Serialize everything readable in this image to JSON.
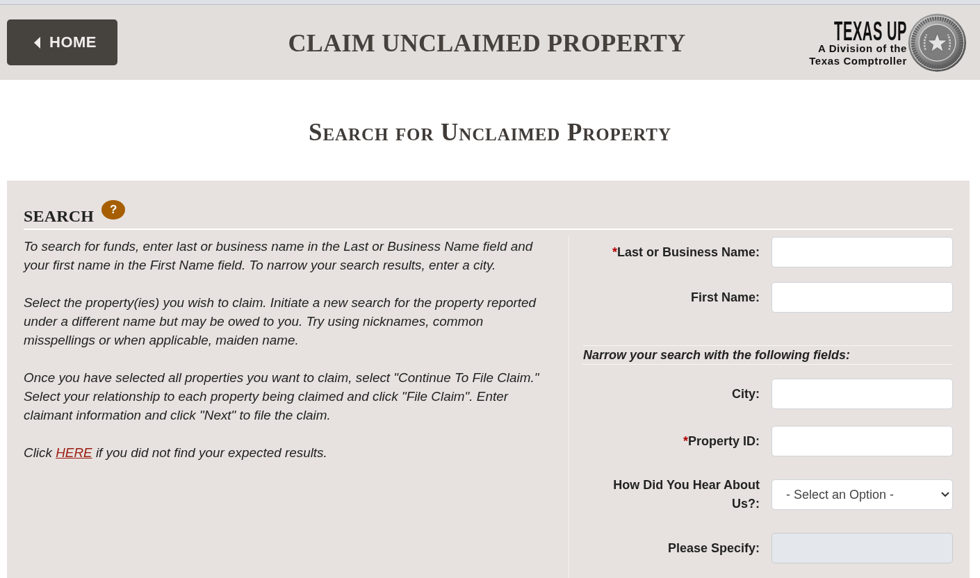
{
  "header": {
    "home_button": "HOME",
    "title": "CLAIM UNCLAIMED PROPERTY",
    "logo": {
      "name": "TEXAS UP",
      "tagline": [
        "A Division of the",
        "Texas Comptroller"
      ]
    }
  },
  "page_title": "Search for Unclaimed Property",
  "search_panel": {
    "heading": "SEARCH",
    "help_button": "?",
    "instructions": [
      {
        "text": "To search for funds, enter last or business name in the Last or Business Name field and your first name in the First Name field. To narrow your search results, enter a city."
      },
      {
        "text": "Select the property(ies) you wish to claim. Initiate a new search for the property reported under a different name but may be owed to you. Try using nicknames, common misspellings or when applicable, maiden name."
      },
      {
        "text": "Once you have selected all properties you want to claim, select \"Continue To File Claim.\" Select your relationship to each property being claimed and click \"File Claim\". Enter claimant information and click \"Next\" to file the claim."
      },
      {
        "text": "Click ",
        "link": "HERE",
        "text_after": " if you did not find your expected results."
      }
    ],
    "form": {
      "fields": [
        {
          "kind": "text",
          "required_mark": "*",
          "label": "Last or Business Name:",
          "disabled": false
        },
        {
          "kind": "text",
          "label": "First Name:",
          "disabled": false
        }
      ],
      "narrow_note": "Narrow your search with the following fields:",
      "narrow_fields": [
        {
          "kind": "text",
          "label": "City:",
          "disabled": false
        },
        {
          "kind": "text",
          "required_mark": "*",
          "label": "Property ID:",
          "disabled": false
        },
        {
          "kind": "select",
          "label": "How Did You Hear About Us?:",
          "value": "- Select an Option -",
          "disabled": false
        },
        {
          "kind": "text",
          "label": "Please Specify:",
          "disabled": true
        }
      ]
    }
  }
}
